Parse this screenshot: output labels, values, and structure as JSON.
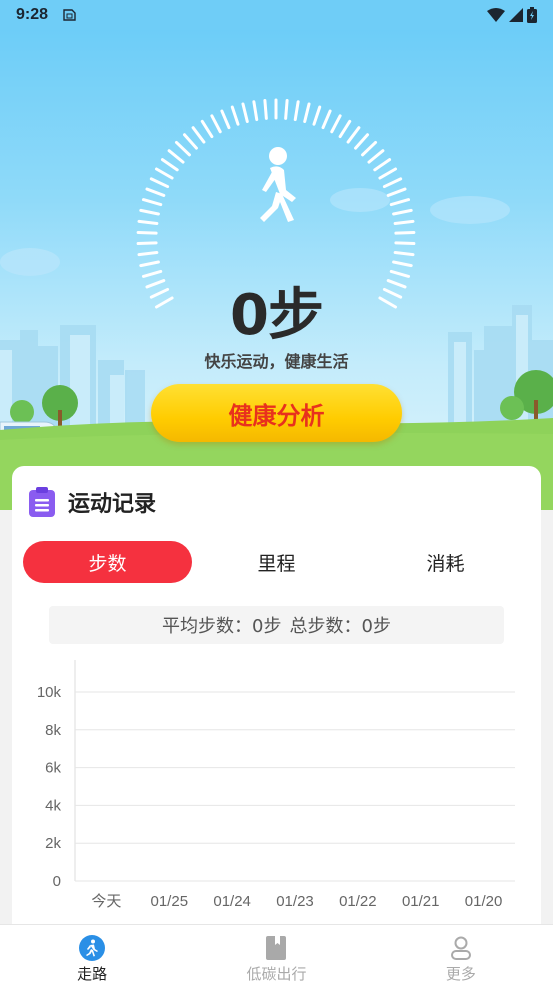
{
  "status_bar": {
    "time": "9:28"
  },
  "hero": {
    "steps_value": "0步",
    "slogan": "快乐运动，健康生活",
    "analysis_button": "健康分析"
  },
  "records": {
    "title": "运动记录",
    "tabs": [
      {
        "label": "步数",
        "active": true
      },
      {
        "label": "里程",
        "active": false
      },
      {
        "label": "消耗",
        "active": false
      }
    ],
    "summary": {
      "average": "平均步数：0步",
      "total": "总步数：0步"
    }
  },
  "chart_data": {
    "type": "bar",
    "categories": [
      "今天",
      "01/25",
      "01/24",
      "01/23",
      "01/22",
      "01/21",
      "01/20"
    ],
    "values": [
      0,
      0,
      0,
      0,
      0,
      0,
      0
    ],
    "ylim": [
      0,
      10000
    ],
    "yticks": [
      0,
      2000,
      4000,
      6000,
      8000,
      10000
    ],
    "ytick_labels": [
      "0",
      "2k",
      "4k",
      "6k",
      "8k",
      "10k"
    ],
    "grid": true,
    "title": "",
    "xlabel": "",
    "ylabel": ""
  },
  "bottom_nav": [
    {
      "label": "走路",
      "icon": "walk-icon",
      "active": true
    },
    {
      "label": "低碳出行",
      "icon": "book-icon",
      "active": false
    },
    {
      "label": "更多",
      "icon": "person-icon",
      "active": false
    }
  ],
  "colors": {
    "accent_red": "#f5313f",
    "button_yellow": "#ffcc00",
    "button_text": "#e8311d",
    "nav_active_blue": "#2a8fe6",
    "grass": "#8ed25a",
    "sky": "#6dcdf8"
  }
}
